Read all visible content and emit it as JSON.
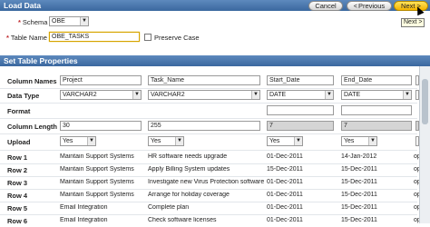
{
  "header": {
    "title": "Load Data",
    "cancel_label": "Cancel",
    "previous_label": "Previous",
    "next_label": "Next >",
    "tooltip": "Next >"
  },
  "form": {
    "schema_label": "Schema",
    "schema_value": "OBE",
    "table_label": "Table Name",
    "table_value": "OBE_TASKS",
    "preserve_label": "Preserve Case"
  },
  "section": {
    "title": "Set Table Properties"
  },
  "grid": {
    "column_names_label": "Column Names",
    "column_names": [
      "Project",
      "Task_Name",
      "Start_Date",
      "End_Date",
      "S"
    ],
    "data_type_label": "Data Type",
    "data_types": [
      "VARCHAR2",
      "VARCHAR2",
      "DATE",
      "DATE",
      "V"
    ],
    "format_label": "Format",
    "column_length_label": "Column Length",
    "column_lengths": [
      "30",
      "255",
      "7",
      "7",
      ""
    ],
    "upload_label": "Upload",
    "uploads": [
      "Yes",
      "Yes",
      "Yes",
      "Yes",
      ""
    ],
    "rows": [
      {
        "label": "Row 1",
        "cells": [
          "Maintain Support Systems",
          "HR software needs upgrade",
          "01-Dec-2011",
          "14-Jan-2012",
          "op"
        ]
      },
      {
        "label": "Row 2",
        "cells": [
          "Maintain Support Systems",
          "Apply Billing System updates",
          "15-Dec-2011",
          "15-Dec-2011",
          "op"
        ]
      },
      {
        "label": "Row 3",
        "cells": [
          "Maintain Support Systems",
          "Investigate new Virus Protection software",
          "01-Dec-2011",
          "15-Dec-2011",
          "op"
        ]
      },
      {
        "label": "Row 4",
        "cells": [
          "Maintain Support Systems",
          "Arrange for holiday coverage",
          "01-Dec-2011",
          "15-Dec-2011",
          "op"
        ]
      },
      {
        "label": "Row 5",
        "cells": [
          "Email Integration",
          "Complete plan",
          "01-Dec-2011",
          "15-Dec-2011",
          "op"
        ]
      },
      {
        "label": "Row 6",
        "cells": [
          "Email Integration",
          "Check software licenses",
          "01-Dec-2011",
          "15-Dec-2011",
          "op"
        ]
      }
    ]
  }
}
